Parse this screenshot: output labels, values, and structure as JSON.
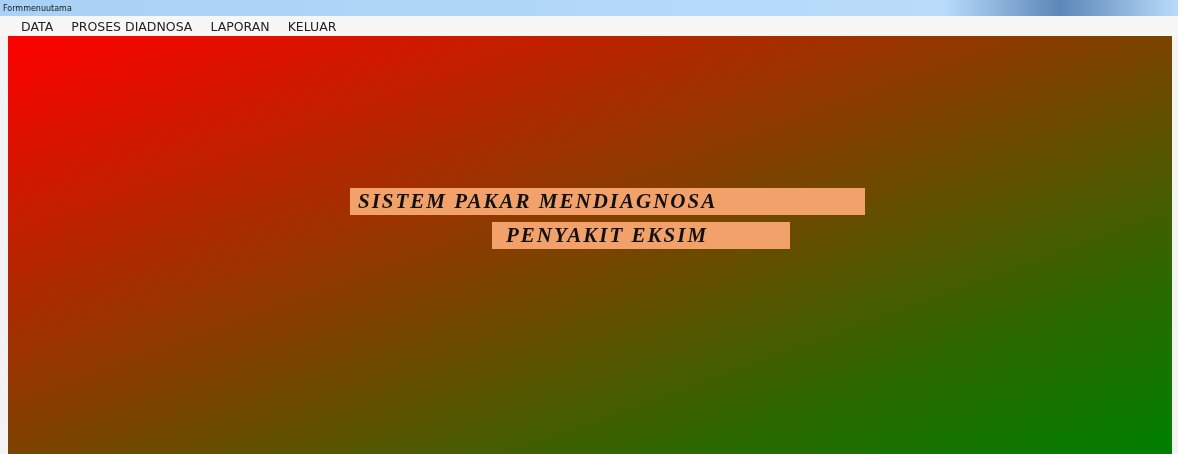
{
  "window": {
    "title": "Formmenuutama"
  },
  "menu": [
    {
      "label": "DATA"
    },
    {
      "label": "PROSES DIADNOSA"
    },
    {
      "label": "LAPORAN"
    },
    {
      "label": "KELUAR"
    }
  ],
  "labels": [
    "SISTEM PAKAR MENDIAGNOSA",
    "PENYAKIT EKSIM"
  ]
}
